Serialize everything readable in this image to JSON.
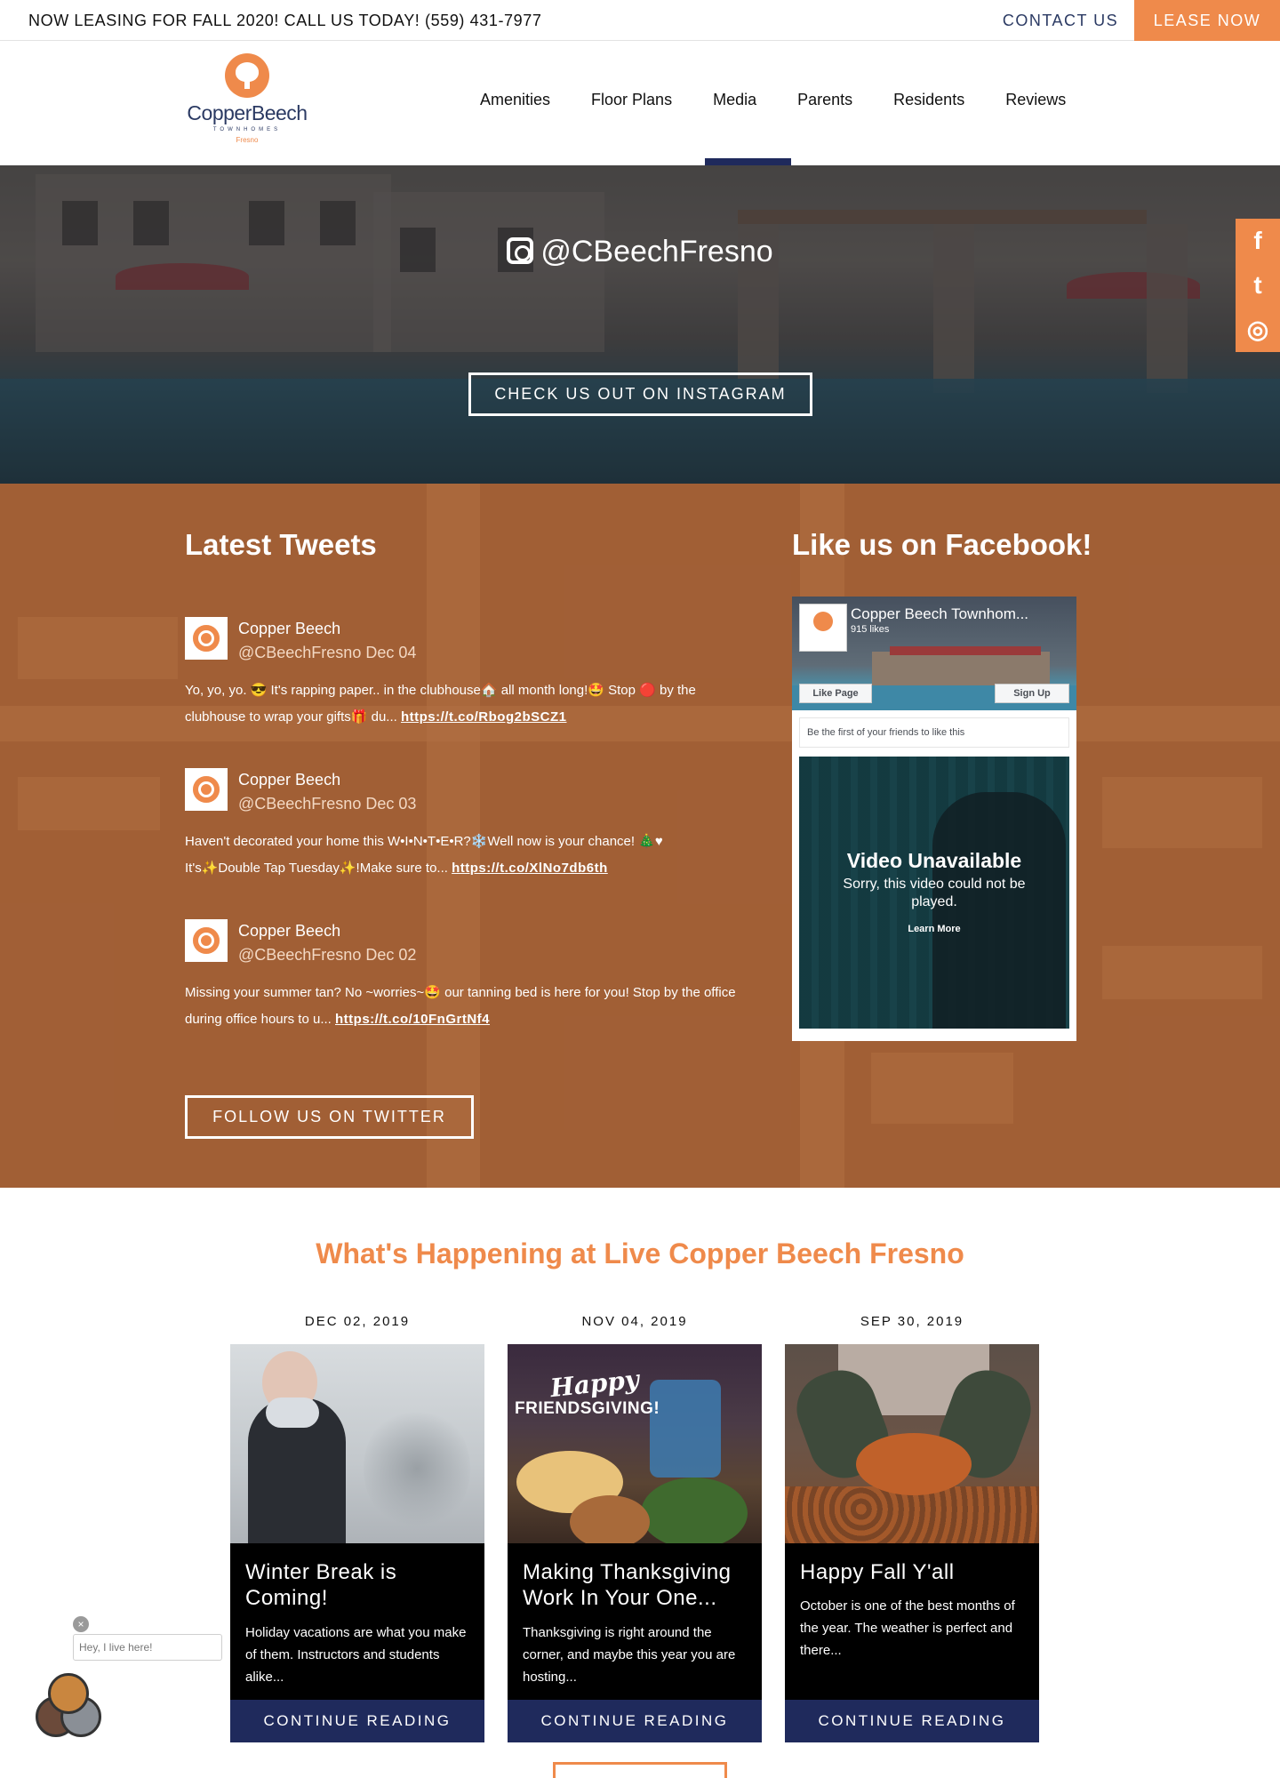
{
  "topbar": {
    "announcement": "NOW LEASING FOR FALL 2020! CALL US TODAY! (559) 431-7977",
    "contact_label": "CONTACT US",
    "lease_label": "LEASE NOW",
    "accent_color": "#ef8a4b"
  },
  "header": {
    "logo": {
      "name": "CopperBeech",
      "sub": "TOWNHOMES",
      "city": "Fresno"
    },
    "nav": [
      "Amenities",
      "Floor Plans",
      "Media",
      "Parents",
      "Residents",
      "Reviews"
    ],
    "active_nav": "Media",
    "brand_navy": "#1f2a5c"
  },
  "hero": {
    "instagram_handle": "@CBeechFresno",
    "instagram_button": "CHECK US OUT ON INSTAGRAM"
  },
  "social_sidebar": {
    "icons": [
      "facebook-icon",
      "twitter-icon",
      "instagram-icon"
    ],
    "glyphs": [
      "f",
      "t",
      "◎"
    ]
  },
  "tweets_section": {
    "title": "Latest Tweets",
    "tweets": [
      {
        "name": "Copper Beech",
        "handle": "@CBeechFresno Dec 04",
        "text": "Yo, yo, yo. 😎 It's rapping paper.. in the clubhouse🏠 all month long!🤩 Stop 🔴 by the clubhouse to wrap your gifts🎁 du...",
        "link": "https://t.co/Rbog2bSCZ1"
      },
      {
        "name": "Copper Beech",
        "handle": "@CBeechFresno Dec 03",
        "text": "Haven't decorated your home this W•I•N•T•E•R?❄️Well now is your chance! 🎄♥ It's✨Double Tap Tuesday✨!Make sure to...",
        "link": "https://t.co/XlNo7db6th"
      },
      {
        "name": "Copper Beech",
        "handle": "@CBeechFresno Dec 02",
        "text": "Missing your summer tan? No ~worries~🤩 our tanning bed is here for you! Stop by the office during office hours to u...",
        "link": "https://t.co/10FnGrtNf4"
      }
    ],
    "follow_button": "FOLLOW US ON TWITTER"
  },
  "facebook": {
    "title": "Like us on Facebook!",
    "page_name": "Copper Beech Townhom...",
    "likes": "915 likes",
    "like_button": "Like Page",
    "signup_button": "Sign Up",
    "friends_text": "Be the first of your friends to like this",
    "video_title": "Video Unavailable",
    "video_message": "Sorry, this video could not be played.",
    "video_link": "Learn More"
  },
  "happenings": {
    "title": "What's Happening at Live Copper Beech Fresno",
    "posts": [
      {
        "date": "DEC 02, 2019",
        "title": "Winter Break is Coming!",
        "excerpt": "Holiday vacations are what you make of them. Instructors and students alike...",
        "cta": "CONTINUE READING"
      },
      {
        "date": "NOV 04, 2019",
        "title": "Making Thanksgiving Work In Your One...",
        "excerpt": "Thanksgiving is right around the corner, and maybe this year you are hosting...",
        "cta": "CONTINUE READING",
        "image_text": [
          "Happy",
          "FRIENDSGIVING!"
        ]
      },
      {
        "date": "SEP 30, 2019",
        "title": "Happy Fall Y'all",
        "excerpt": "October is one of the best months of the year. The weather is perfect and there...",
        "cta": "CONTINUE READING"
      }
    ]
  },
  "chat": {
    "bubble_text": "Hey, I live here!",
    "close_glyph": "×"
  }
}
